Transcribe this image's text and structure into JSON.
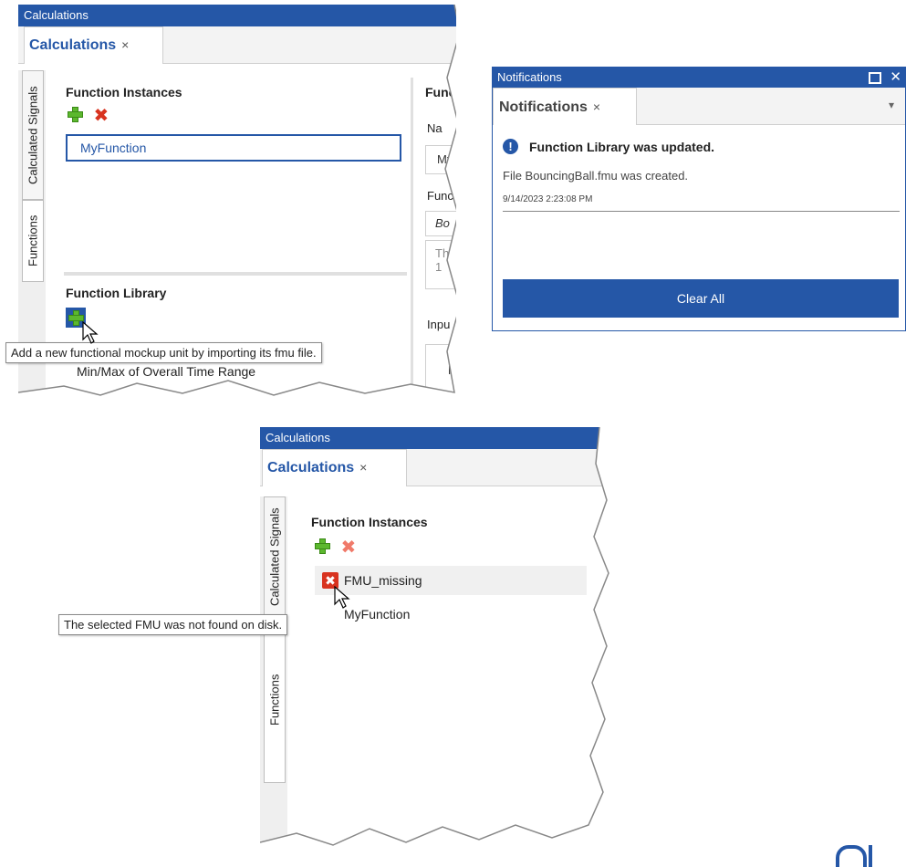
{
  "panel1": {
    "title": "Calculations",
    "tab_label": "Calculations",
    "tab_close": "×",
    "vtabs": [
      "Calculated Signals",
      "Functions"
    ],
    "instances_heading": "Function Instances",
    "instance_item": "MyFunction",
    "library_heading": "Function Library",
    "library_items": [
      "Min/Max of Overall Time Range"
    ],
    "tooltip": "Add a new functional mockup unit by importing its fmu file.",
    "right": {
      "heading": "Func",
      "name_label": "Na",
      "name_value": "My",
      "func_label": "Func",
      "func_value": "Bo",
      "desc": "Th",
      "desc2": "1",
      "input_label": "Inpu",
      "input_value": "N"
    }
  },
  "notifications": {
    "title": "Notifications",
    "tab_label": "Notifications",
    "tab_close": "×",
    "message_title": "Function Library was updated.",
    "message_body": "File BouncingBall.fmu was created.",
    "timestamp": "9/14/2023 2:23:08 PM",
    "clear_button": "Clear All"
  },
  "panel2": {
    "title": "Calculations",
    "tab_label": "Calculations",
    "tab_close": "×",
    "vtabs": [
      "Calculated Signals",
      "Functions"
    ],
    "instances_heading": "Function Instances",
    "items": [
      "FMU_missing",
      "MyFunction"
    ],
    "tooltip": "The selected FMU was not found on disk."
  },
  "colors": {
    "accent": "#2557a7",
    "plus": "#5cb82e",
    "delete": "#d8331f"
  }
}
